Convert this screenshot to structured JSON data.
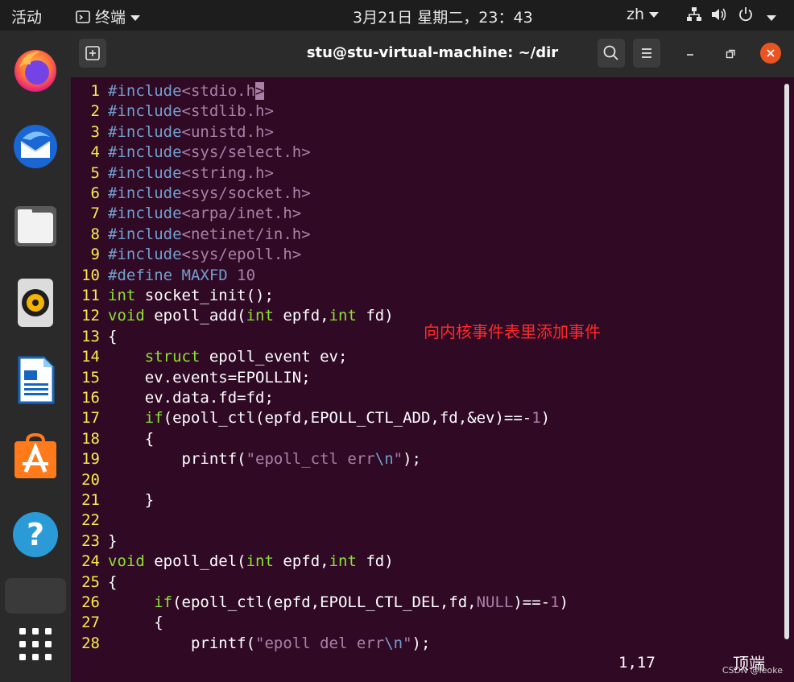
{
  "topbar": {
    "activities": "活动",
    "app_menu": "终端",
    "clock": "3月21日 星期二，23：43",
    "input_method": "zh"
  },
  "window": {
    "title": "stu@stu-virtual-machine: ~/dir"
  },
  "code_lines": [
    {
      "n": "1",
      "segs": [
        [
          "pp",
          "#include"
        ],
        [
          "str",
          "<stdio.h"
        ],
        [
          "cur",
          ">"
        ]
      ]
    },
    {
      "n": "2",
      "segs": [
        [
          "pp",
          "#include"
        ],
        [
          "str",
          "<stdlib.h>"
        ]
      ]
    },
    {
      "n": "3",
      "segs": [
        [
          "pp",
          "#include"
        ],
        [
          "str",
          "<unistd.h>"
        ]
      ]
    },
    {
      "n": "4",
      "segs": [
        [
          "pp",
          "#include"
        ],
        [
          "str",
          "<sys/select.h>"
        ]
      ]
    },
    {
      "n": "5",
      "segs": [
        [
          "pp",
          "#include"
        ],
        [
          "str",
          "<string.h>"
        ]
      ]
    },
    {
      "n": "6",
      "segs": [
        [
          "pp",
          "#include"
        ],
        [
          "str",
          "<sys/socket.h>"
        ]
      ]
    },
    {
      "n": "7",
      "segs": [
        [
          "pp",
          "#include"
        ],
        [
          "str",
          "<arpa/inet.h>"
        ]
      ]
    },
    {
      "n": "8",
      "segs": [
        [
          "pp",
          "#include"
        ],
        [
          "str",
          "<netinet/in.h>"
        ]
      ]
    },
    {
      "n": "9",
      "segs": [
        [
          "pp",
          "#include"
        ],
        [
          "str",
          "<sys/epoll.h>"
        ]
      ]
    },
    {
      "n": "10",
      "segs": [
        [
          "pp",
          "#define MAXFD "
        ],
        [
          "str",
          "10"
        ]
      ]
    },
    {
      "n": "11",
      "segs": [
        [
          "kw",
          "int"
        ],
        [
          "n",
          " socket_init();"
        ]
      ]
    },
    {
      "n": "12",
      "segs": [
        [
          "kw",
          "void"
        ],
        [
          "n",
          " epoll_add("
        ],
        [
          "kw",
          "int"
        ],
        [
          "n",
          " epfd,"
        ],
        [
          "kw",
          "int"
        ],
        [
          "n",
          " fd)"
        ]
      ]
    },
    {
      "n": "13",
      "segs": [
        [
          "n",
          "{"
        ]
      ]
    },
    {
      "n": "14",
      "segs": [
        [
          "n",
          "    "
        ],
        [
          "kw",
          "struct"
        ],
        [
          "n",
          " epoll_event ev;"
        ]
      ]
    },
    {
      "n": "15",
      "segs": [
        [
          "n",
          "    ev.events=EPOLLIN;"
        ]
      ]
    },
    {
      "n": "16",
      "segs": [
        [
          "n",
          "    ev.data.fd=fd;"
        ]
      ]
    },
    {
      "n": "17",
      "segs": [
        [
          "n",
          "    "
        ],
        [
          "kw",
          "if"
        ],
        [
          "n",
          "(epoll_ctl(epfd,EPOLL_CTL_ADD,fd,&ev)==-"
        ],
        [
          "str",
          "1"
        ],
        [
          "n",
          ")"
        ]
      ]
    },
    {
      "n": "18",
      "segs": [
        [
          "n",
          "    {"
        ]
      ]
    },
    {
      "n": "19",
      "segs": [
        [
          "n",
          "        printf("
        ],
        [
          "str",
          "\"epoll_ctl err"
        ],
        [
          "pp",
          "\\n"
        ],
        [
          "str",
          "\""
        ],
        [
          "n",
          ");"
        ]
      ]
    },
    {
      "n": "20",
      "segs": []
    },
    {
      "n": "21",
      "segs": [
        [
          "n",
          "    }"
        ]
      ]
    },
    {
      "n": "22",
      "segs": []
    },
    {
      "n": "23",
      "segs": [
        [
          "n",
          "}"
        ]
      ]
    },
    {
      "n": "24",
      "segs": [
        [
          "kw",
          "void"
        ],
        [
          "n",
          " epoll_del("
        ],
        [
          "kw",
          "int"
        ],
        [
          "n",
          " epfd,"
        ],
        [
          "kw",
          "int"
        ],
        [
          "n",
          " fd)"
        ]
      ]
    },
    {
      "n": "25",
      "segs": [
        [
          "n",
          "{"
        ]
      ]
    },
    {
      "n": "26",
      "segs": [
        [
          "n",
          "     "
        ],
        [
          "kw",
          "if"
        ],
        [
          "n",
          "(epoll_ctl(epfd,EPOLL_CTL_DEL,fd,"
        ],
        [
          "str",
          "NULL"
        ],
        [
          "n",
          ")==-"
        ],
        [
          "str",
          "1"
        ],
        [
          "n",
          ")"
        ]
      ]
    },
    {
      "n": "27",
      "segs": [
        [
          "n",
          "     {"
        ]
      ]
    },
    {
      "n": "28",
      "segs": [
        [
          "n",
          "         printf("
        ],
        [
          "str",
          "\"epoll del err"
        ],
        [
          "pp",
          "\\n"
        ],
        [
          "str",
          "\""
        ],
        [
          "n",
          ");"
        ]
      ]
    }
  ],
  "annotation": "向内核事件表里添加事件",
  "status": {
    "cursor_pos": "1,17",
    "scroll_pos": "顶端"
  },
  "watermark": "CSDN @leoke",
  "colors": {
    "terminal_bg": "#300a24",
    "line_number": "#fce94f",
    "preprocessor": "#729fcf",
    "string": "#ad7fa8",
    "keyword": "#8ae234",
    "annotation": "#ff2a2a"
  }
}
